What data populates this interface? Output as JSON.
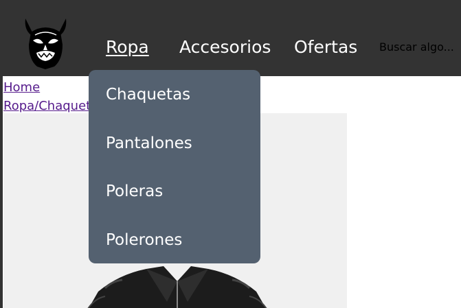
{
  "nav": {
    "links": [
      {
        "label": "Ropa",
        "active": true
      },
      {
        "label": "Accesorios",
        "active": false
      },
      {
        "label": "Ofertas",
        "active": false
      }
    ],
    "search_placeholder": "Buscar algo..."
  },
  "breadcrumb": [
    "Home",
    "Ropa/Chaquetas"
  ],
  "dropdown": {
    "items": [
      "Chaquetas",
      "Pantalones",
      "Poleras",
      "Polerones"
    ]
  },
  "colors": {
    "navbar_bg": "#333333",
    "dropdown_bg": "#546170",
    "visited_link": "#551a8b",
    "product_bg": "#f0f0f0"
  },
  "icons": {
    "logo": "oni-mask-icon"
  }
}
